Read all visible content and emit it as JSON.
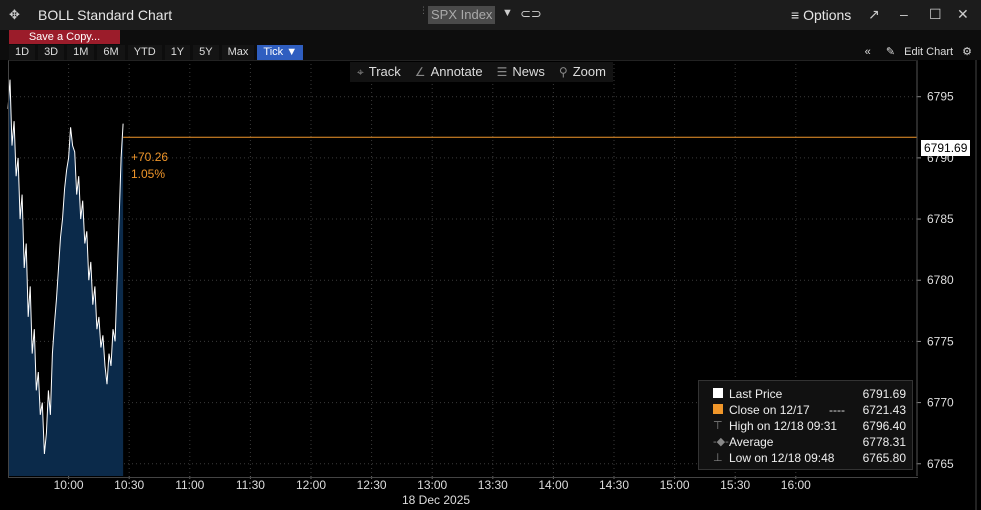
{
  "window": {
    "title": "BOLL Standard Chart",
    "ticker": "SPX Index",
    "options_label": "Options"
  },
  "toolbar": {
    "save_label": "Save a Copy...",
    "ranges": [
      "1D",
      "3D",
      "1M",
      "6M",
      "YTD",
      "1Y",
      "5Y",
      "Max",
      "Tick ▼"
    ],
    "active_range": "Tick ▼",
    "edit_chart_label": "Edit Chart"
  },
  "chart_tools": [
    {
      "label": "Track",
      "icon": "crosshair-icon"
    },
    {
      "label": "Annotate",
      "icon": "pencil-icon"
    },
    {
      "label": "News",
      "icon": "news-icon"
    },
    {
      "label": "Zoom",
      "icon": "zoom-icon"
    }
  ],
  "change": {
    "abs": "+70.26",
    "pct": "1.05%"
  },
  "last_price_tag": "6791.69",
  "legend": {
    "last_price": {
      "label": "Last Price",
      "value": "6791.69"
    },
    "close": {
      "label": "Close on 12/17",
      "value": "6721.43",
      "dashes": "----"
    },
    "high": {
      "label": "High on 12/18 09:31",
      "value": "6796.40"
    },
    "average": {
      "label": "Average",
      "value": "6778.31"
    },
    "low": {
      "label": "Low on 12/18 09:48",
      "value": "6765.80"
    }
  },
  "date_label": "18 Dec 2025",
  "colors": {
    "accent_orange": "#f0962a",
    "area_fill": "#0b2a4a",
    "save_button": "#9b1c2a",
    "active_tab": "#2f5ec0"
  },
  "chart_data": {
    "type": "area",
    "ylim": [
      6764,
      6798
    ],
    "xlim_minutes": [
      570,
      1020
    ],
    "yticks": [
      6765,
      6770,
      6775,
      6780,
      6785,
      6790,
      6795
    ],
    "xticks": [
      {
        "m": 600,
        "label": "10:00"
      },
      {
        "m": 630,
        "label": "10:30"
      },
      {
        "m": 660,
        "label": "11:00"
      },
      {
        "m": 690,
        "label": "11:30"
      },
      {
        "m": 720,
        "label": "12:00"
      },
      {
        "m": 750,
        "label": "12:30"
      },
      {
        "m": 780,
        "label": "13:00"
      },
      {
        "m": 810,
        "label": "13:30"
      },
      {
        "m": 840,
        "label": "14:00"
      },
      {
        "m": 870,
        "label": "14:30"
      },
      {
        "m": 900,
        "label": "15:00"
      },
      {
        "m": 930,
        "label": "15:30"
      },
      {
        "m": 960,
        "label": "16:00"
      }
    ],
    "last_price_level": 6791.69,
    "series": [
      {
        "x": [
          "09:30",
          "09:31",
          "09:32",
          "09:33",
          "09:34",
          "09:35",
          "09:36",
          "09:37",
          "09:38",
          "09:39",
          "09:40",
          "09:41",
          "09:42",
          "09:43",
          "09:44",
          "09:45",
          "09:46",
          "09:47",
          "09:48",
          "09:49",
          "09:50",
          "09:51",
          "09:52",
          "09:53",
          "09:54",
          "09:55",
          "09:56",
          "09:57",
          "09:58",
          "09:59",
          "10:00",
          "10:01",
          "10:02",
          "10:03",
          "10:04",
          "10:05",
          "10:06",
          "10:07",
          "10:08",
          "10:09",
          "10:10",
          "10:11",
          "10:12",
          "10:13",
          "10:14",
          "10:15",
          "10:16",
          "10:17",
          "10:18",
          "10:19",
          "10:20",
          "10:21",
          "10:22",
          "10:23",
          "10:24",
          "10:25",
          "10:26",
          "10:27"
        ],
        "y": [
          6794.0,
          6796.4,
          6791.0,
          6793.0,
          6788.5,
          6790.0,
          6785.0,
          6787.0,
          6781.0,
          6783.0,
          6777.0,
          6779.5,
          6774.0,
          6776.0,
          6771.0,
          6772.5,
          6769.0,
          6770.0,
          6765.8,
          6767.5,
          6771.0,
          6769.0,
          6774.0,
          6776.5,
          6778.5,
          6781.0,
          6783.5,
          6785.0,
          6787.5,
          6789.0,
          6790.0,
          6792.5,
          6791.0,
          6790.5,
          6787.0,
          6788.5,
          6785.0,
          6786.5,
          6783.0,
          6784.0,
          6780.0,
          6781.5,
          6778.0,
          6779.5,
          6776.0,
          6777.0,
          6774.5,
          6775.5,
          6773.0,
          6771.5,
          6774.0,
          6773.0,
          6776.0,
          6775.0,
          6780.0,
          6785.0,
          6790.0,
          6792.8
        ]
      }
    ]
  }
}
